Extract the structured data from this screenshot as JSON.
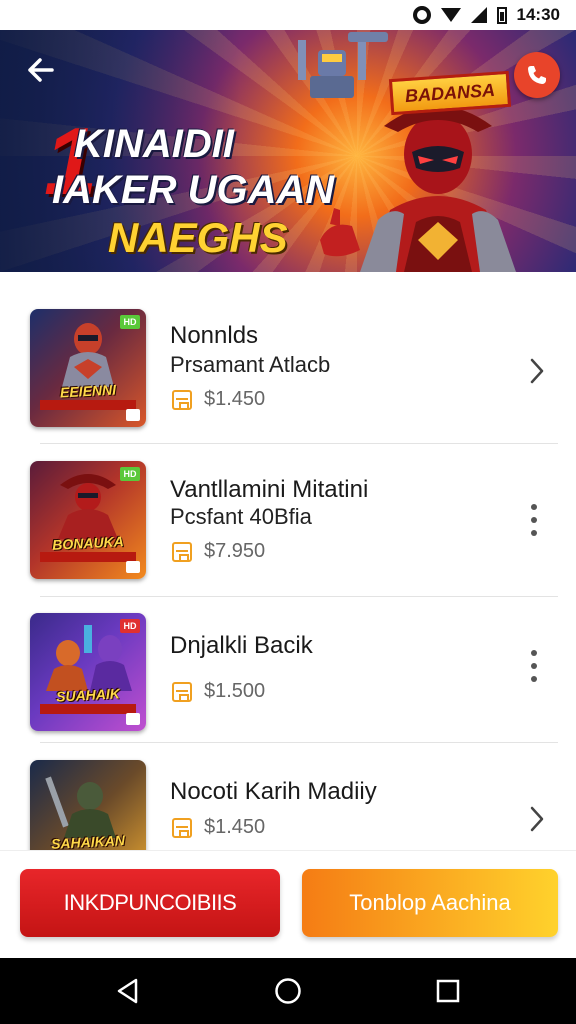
{
  "status_bar": {
    "time": "14:30",
    "icons": [
      "gear-icon",
      "wifi-icon",
      "signal-icon",
      "battery-icon"
    ]
  },
  "banner": {
    "title_number": "1",
    "title_lines": [
      "KINAIDII",
      "IAKER UGAAN",
      "NAEGHS"
    ],
    "badge": "BADANSA",
    "back_icon": "back-arrow-icon",
    "call_icon": "phone-icon"
  },
  "items": [
    {
      "name": "Nonnlds",
      "subtitle": "Prsamant Atlacb",
      "price": "$1.450",
      "thumb_title": "EEIENNI",
      "thumb_badge": "HD",
      "trailing": "chevron-right-icon",
      "thumb_colors": [
        "#1d2f6a",
        "#d9572a"
      ]
    },
    {
      "name": "Vantllamini Mitatini",
      "subtitle": "Pcsfant 40Bfia",
      "price": "$7.950",
      "thumb_title": "BONAUKA",
      "thumb_badge": "HD",
      "trailing": "more-vertical-icon",
      "thumb_colors": [
        "#5a1c3a",
        "#f28a1e"
      ]
    },
    {
      "name": "Dnjalkli Bacik",
      "subtitle": "",
      "price": "$1.500",
      "thumb_title": "SUAHAIK",
      "thumb_badge": "HD",
      "trailing": "more-vertical-icon",
      "thumb_colors": [
        "#3a2a8a",
        "#c04fd0"
      ]
    },
    {
      "name": "Nocoti Karih Madiiy",
      "subtitle": "",
      "price": "$1.450",
      "thumb_title": "SAHAIKAN",
      "thumb_badge": "",
      "trailing": "chevron-right-icon",
      "thumb_colors": [
        "#1a2a4a",
        "#e0a030"
      ]
    }
  ],
  "actions": {
    "primary_label": "INKDPUNCOIBIIS",
    "secondary_label": "Tonblop Aachina"
  },
  "nav": {
    "icons": [
      "nav-back-icon",
      "nav-home-icon",
      "nav-recents-icon"
    ]
  },
  "colors": {
    "primary_button": "#d41c1e",
    "secondary_button_start": "#f57c14",
    "secondary_button_end": "#ffd22c",
    "accent": "#f0a020"
  }
}
